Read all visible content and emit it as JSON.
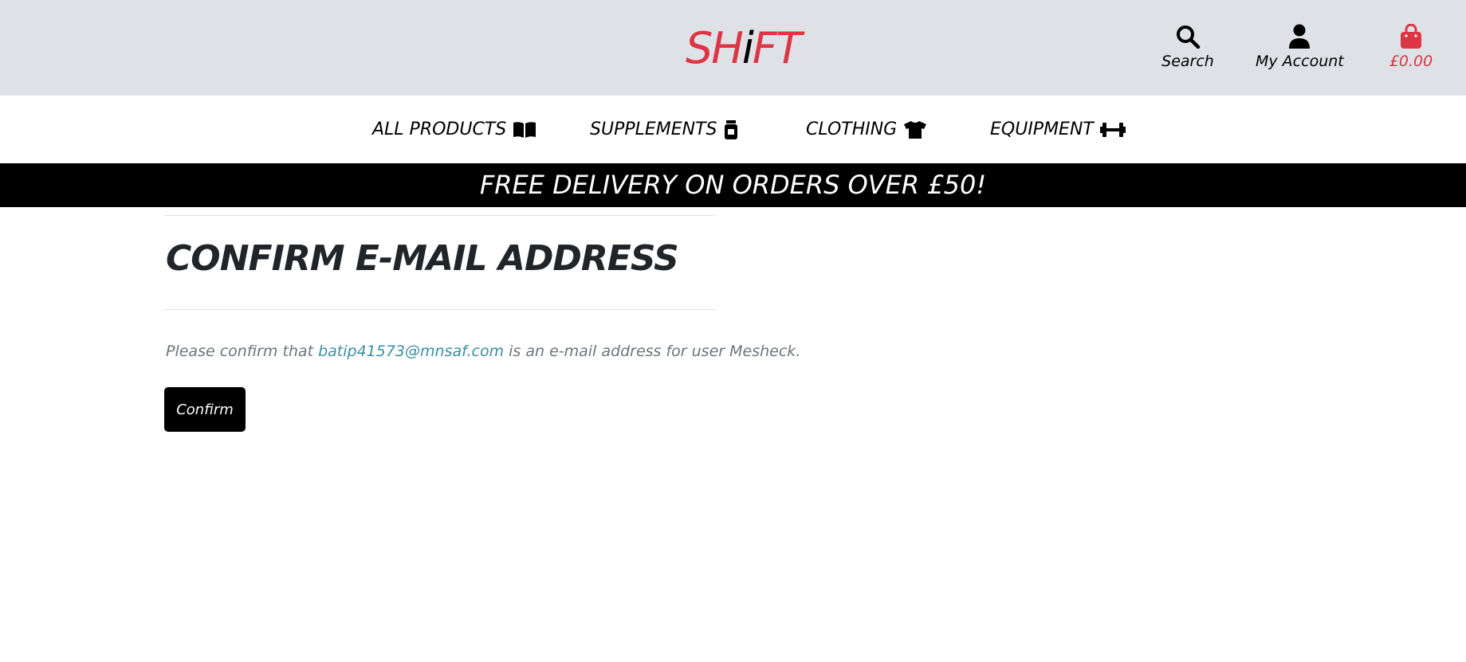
{
  "header": {
    "logo_prefix": "SH",
    "logo_i": "i",
    "logo_suffix": "FT",
    "search_label": "Search",
    "account_label": "My Account",
    "bag_total": "£0.00",
    "icons": {
      "search": "search-icon",
      "account": "user-icon",
      "bag": "shopping-bag-icon"
    },
    "colors": {
      "brand": "#dc3545",
      "header_bg": "#dee2e6"
    }
  },
  "nav": {
    "items": [
      {
        "label": "ALL PRODUCTS",
        "icon": "book-open-icon"
      },
      {
        "label": "SUPPLEMENTS",
        "icon": "jar-icon"
      },
      {
        "label": "CLOTHING",
        "icon": "tshirt-icon"
      },
      {
        "label": "EQUIPMENT",
        "icon": "dumbbell-icon"
      }
    ]
  },
  "banner": {
    "text": "FREE DELIVERY ON ORDERS OVER £50!"
  },
  "main": {
    "title": "CONFIRM E-MAIL ADDRESS",
    "message_prefix": "Please confirm that ",
    "email": "batip41573@mnsaf.com",
    "message_suffix": " is an e-mail address for user Mesheck.",
    "confirm_label": "Confirm"
  }
}
